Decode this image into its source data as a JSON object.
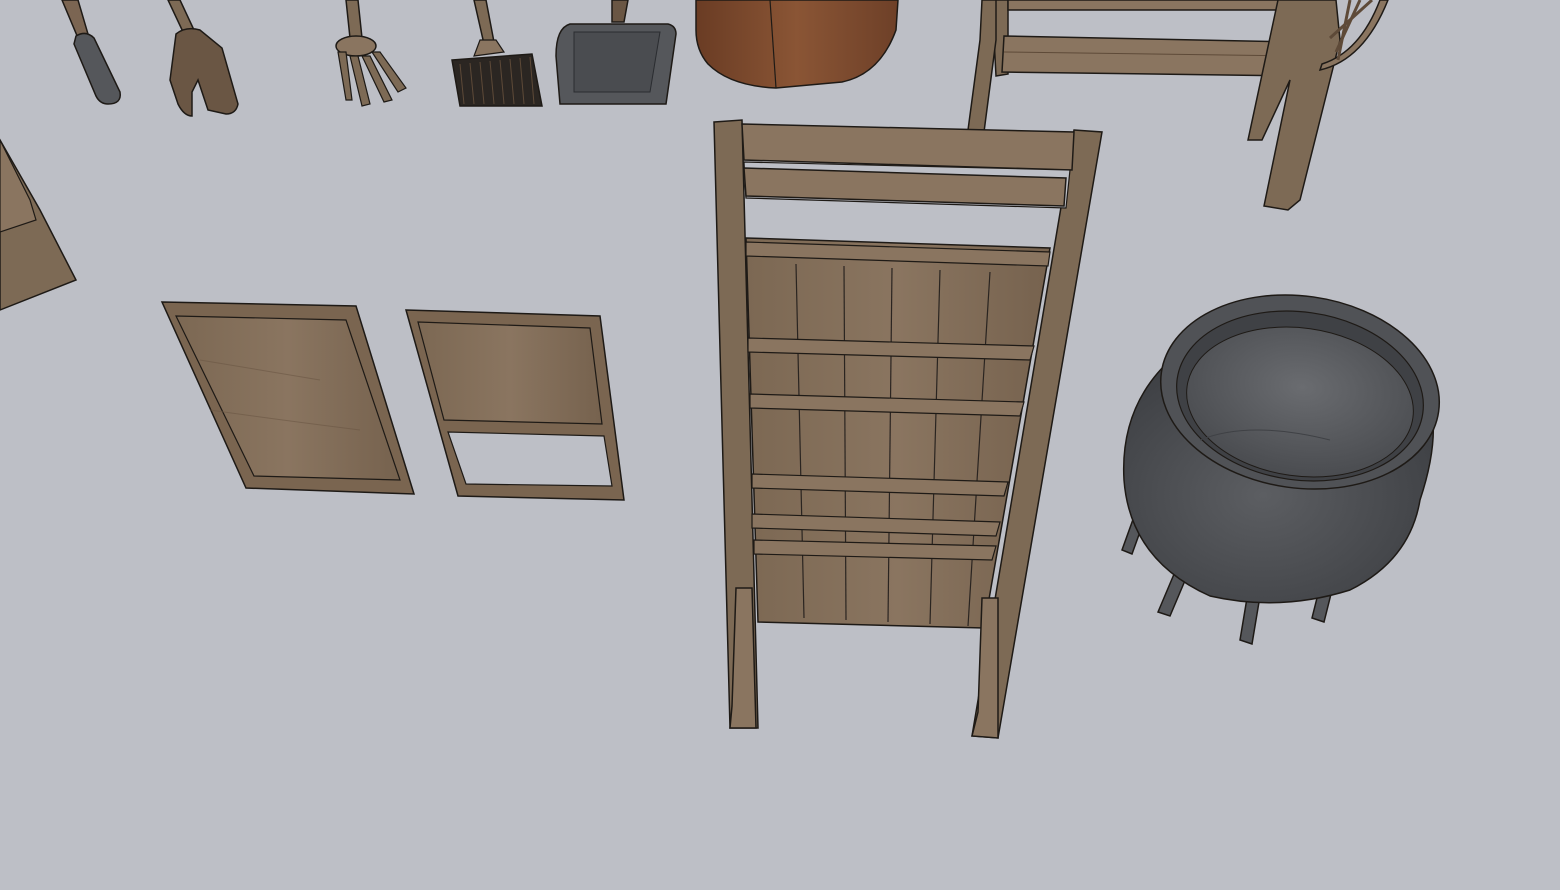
{
  "viewport": {
    "background": "#bdbfc6",
    "camera": "top-down-perspective"
  },
  "scene": {
    "objects": [
      {
        "name": "tool-handle",
        "material": "dark-gray-metal"
      },
      {
        "name": "wooden-spade",
        "material": "wood"
      },
      {
        "name": "garden-fork",
        "material": "wood"
      },
      {
        "name": "broom",
        "material": "wood-and-bristle"
      },
      {
        "name": "dustpan",
        "material": "gray-metal"
      },
      {
        "name": "wooden-barrel",
        "material": "dark-wood"
      },
      {
        "name": "wooden-bench",
        "material": "wood"
      },
      {
        "name": "wagon-wheel",
        "material": "wood"
      },
      {
        "name": "wooden-crate",
        "material": "wood"
      },
      {
        "name": "wooden-panel",
        "material": "wood"
      },
      {
        "name": "washboard-small",
        "material": "wood"
      },
      {
        "name": "wooden-rack",
        "material": "wood"
      },
      {
        "name": "iron-cauldron",
        "material": "cast-iron"
      }
    ]
  },
  "colors": {
    "wood_light": "#8a7560",
    "wood_mid": "#7a6550",
    "wood_dark": "#5e4a38",
    "barrel": "#7a4a30",
    "metal": "#55575b",
    "metal_dark": "#3d3f43",
    "outline": "#1e1a16"
  }
}
